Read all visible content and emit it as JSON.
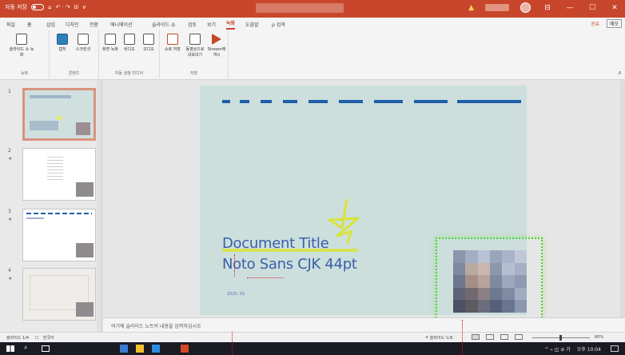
{
  "app": {
    "titlebar": {
      "qat": [
        "자동 저장",
        "⌂",
        "↶ · ↷",
        "ᗯ",
        "∨"
      ],
      "warn_icon": "warning-icon",
      "controls": [
        "—",
        "☐",
        "✕"
      ]
    },
    "tabs": [
      {
        "label": "파일",
        "active": false
      },
      {
        "label": "홈",
        "active": false
      },
      {
        "label": "삽입",
        "active": false
      },
      {
        "label": "디자인",
        "active": false
      },
      {
        "label": "전환",
        "active": false
      },
      {
        "label": "애니메이션",
        "active": false
      },
      {
        "label": "슬라이드 쇼",
        "active": false
      },
      {
        "label": "검토",
        "active": false
      },
      {
        "label": "보기",
        "active": false
      },
      {
        "label": "녹화",
        "active": true
      },
      {
        "label": "도움말",
        "active": false
      },
      {
        "label": "ρ 검색",
        "active": false
      }
    ],
    "share": "공유",
    "comment": "메모",
    "ribbon": {
      "groups": [
        {
          "label": "녹화",
          "buttons": [
            "슬라이드 쇼 녹화"
          ]
        },
        {
          "label": "콘텐츠",
          "buttons": [
            "캡처",
            "스크린샷"
          ]
        },
        {
          "label": "자동 실행 미디어",
          "buttons": [
            "화면 녹화",
            "비디오",
            "오디오"
          ]
        },
        {
          "label": "저장",
          "buttons": [
            "쇼로 저장",
            "동영상으로 내보내기",
            "Stream에 게시"
          ]
        }
      ]
    },
    "slides_pane": {
      "slides": [
        {
          "num": "1",
          "selected": true
        },
        {
          "num": "2",
          "selected": false
        },
        {
          "num": "3",
          "selected": false
        },
        {
          "num": "4",
          "selected": false
        }
      ]
    },
    "slide": {
      "title_line1": "Document Title",
      "title_line2": "Noto Sans CJK 44pt",
      "date": "2020. 05"
    },
    "notes_placeholder": "여기에 슬라이드 노트의 내용을 입력하십시오",
    "status": {
      "slide_info": "슬라이드 1/4",
      "language": "한국어",
      "notes_button": "≙ 슬라이드 노트",
      "zoom": "60%"
    },
    "taskbar": {
      "clock": "오후 10:04",
      "tray": "^ ⌁ ◫ ⊘ 가"
    },
    "colors": {
      "accent": "#c8462b",
      "slide_bg": "#ccdfdd",
      "title": "#3b5fa7",
      "dash": "#1f5ea8",
      "selection": "#46d32c"
    }
  }
}
